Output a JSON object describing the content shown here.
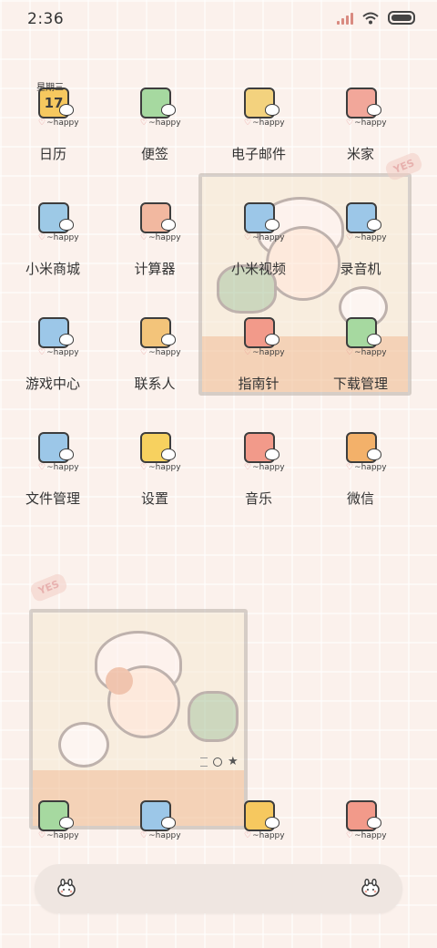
{
  "status": {
    "time": "2:36"
  },
  "happy_text": "~happy",
  "calendar_weekday": "星期三",
  "calendar_day": "17",
  "apps": [
    {
      "label": "日历",
      "icon": "calendar-icon",
      "color": "#f6c85f"
    },
    {
      "label": "便签",
      "icon": "notes-icon",
      "color": "#a6d9a0"
    },
    {
      "label": "电子邮件",
      "icon": "mail-icon",
      "color": "#f3d27e"
    },
    {
      "label": "米家",
      "icon": "puzzle-icon",
      "color": "#f2a79a"
    },
    {
      "label": "小米商城",
      "icon": "shopping-cart-icon",
      "color": "#9dc9e6"
    },
    {
      "label": "计算器",
      "icon": "calculator-icon",
      "color": "#f2b8a0"
    },
    {
      "label": "小米视频",
      "icon": "video-play-icon",
      "color": "#9cc7e8"
    },
    {
      "label": "录音机",
      "icon": "cassette-icon",
      "color": "#9cc7e8"
    },
    {
      "label": "游戏中心",
      "icon": "gamepad-icon",
      "color": "#9cc7e8"
    },
    {
      "label": "联系人",
      "icon": "contacts-icon",
      "color": "#f3c47a"
    },
    {
      "label": "指南针",
      "icon": "compass-icon",
      "color": "#f29a8a"
    },
    {
      "label": "下载管理",
      "icon": "download-tray-icon",
      "color": "#a6d9a0"
    },
    {
      "label": "文件管理",
      "icon": "folder-icon",
      "color": "#9cc7e8"
    },
    {
      "label": "设置",
      "icon": "gear-icon",
      "color": "#f7d15f"
    },
    {
      "label": "音乐",
      "icon": "music-note-icon",
      "color": "#f29a8a"
    },
    {
      "label": "微信",
      "icon": "chat-bubbles-icon",
      "color": "#f3b16a"
    }
  ],
  "dock": [
    {
      "icon": "phone-icon",
      "color": "#a6d9a0"
    },
    {
      "icon": "browser-icon",
      "color": "#9cc7e8"
    },
    {
      "icon": "camera-icon",
      "color": "#f6c85f"
    },
    {
      "icon": "messages-icon",
      "color": "#f29a8a"
    }
  ],
  "wallpaper_tag": "YES",
  "colors": {
    "background": "#fbf1ec",
    "search_bar": "#efe6e1",
    "outline": "#3d3d3d"
  }
}
